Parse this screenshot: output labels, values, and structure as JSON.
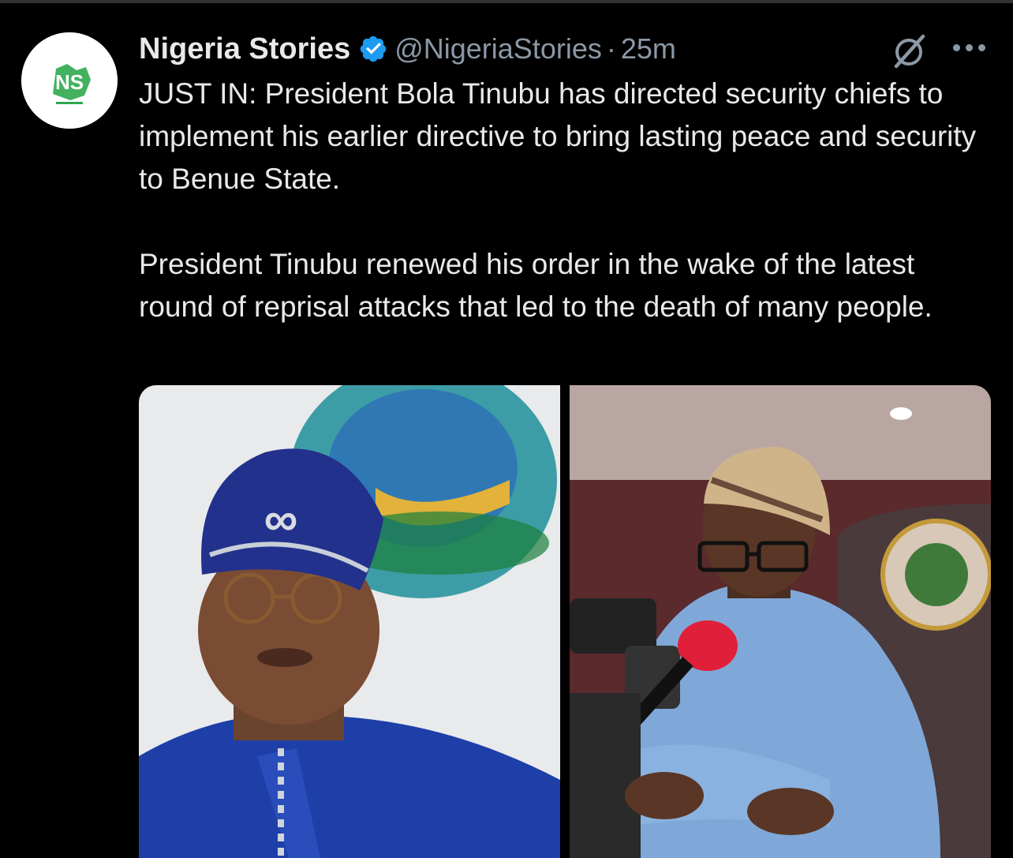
{
  "tweet": {
    "author_name": "Nigeria Stories",
    "handle": "@NigeriaStories",
    "separator": "·",
    "time": "25m",
    "avatar_logo_text": "NS",
    "paragraphs": [
      "JUST IN: President Bola Tinubu has directed security chiefs to implement his earlier directive to bring lasting peace and security to Benue State.",
      "President Tinubu renewed his order in the wake of the latest round of reprisal attacks that led to the death of many people."
    ]
  },
  "icons": {
    "verified": "verified-badge-icon",
    "grok": "grok-icon",
    "more": "more-options-icon"
  },
  "colors": {
    "background": "#000000",
    "text": "#e7e9ea",
    "secondary": "#8b98a5",
    "verified": "#1d9bf0",
    "logo_green": "#2fa84f"
  }
}
